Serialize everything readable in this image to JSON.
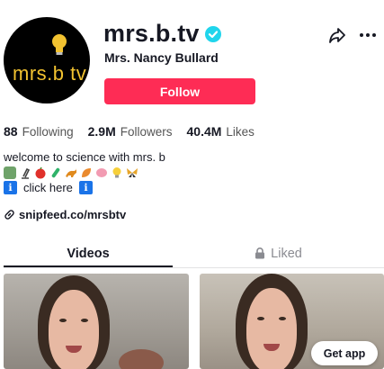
{
  "profile": {
    "avatar_text": "mrs.b tv",
    "username": "mrs.b.tv",
    "display_name": "Mrs. Nancy Bullard",
    "verified": true,
    "follow_label": "Follow"
  },
  "stats": {
    "following_count": "88",
    "following_label": "Following",
    "followers_count": "2.9M",
    "followers_label": "Followers",
    "likes_count": "40.4M",
    "likes_label": "Likes"
  },
  "bio": {
    "line1": "welcome to science with mrs. b",
    "emojis": [
      "scientist-icon",
      "microscope-icon",
      "apple-icon",
      "test-tube-icon",
      "dinosaur-icon",
      "leaf-icon",
      "brain-icon",
      "lightbulb-icon",
      "butterfly-icon"
    ],
    "info_glyph": "ℹ",
    "click_text": "click here"
  },
  "link": {
    "text": "snipfeed.co/mrsbtv"
  },
  "tabs": {
    "videos": "Videos",
    "liked": "Liked"
  },
  "cta": {
    "get_app": "Get app"
  },
  "colors": {
    "follow": "#fe2c55",
    "verified": "#20d5ec",
    "info_icon": "#1a73e8",
    "avatar_text": "#f2c230"
  }
}
